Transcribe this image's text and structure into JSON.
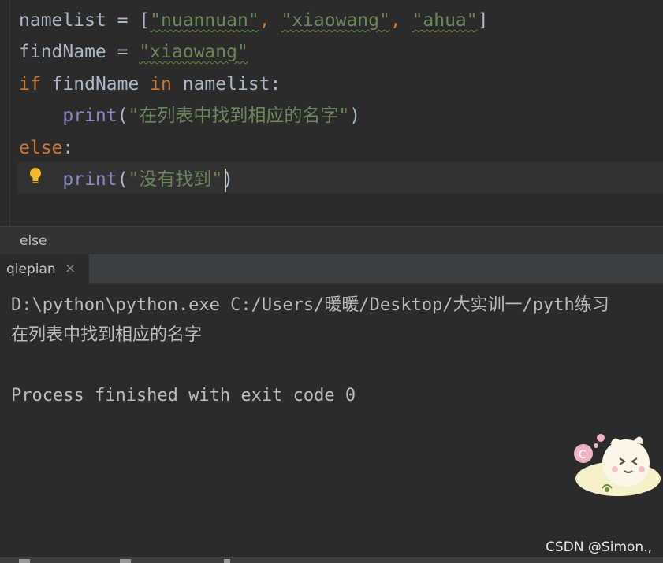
{
  "editor": {
    "lines": [
      {
        "tokens": [
          {
            "text": "namelist = [",
            "cls": ""
          },
          {
            "text": "\"nuannuan\"",
            "cls": "str",
            "squiggle": true
          },
          {
            "text": ", ",
            "cls": "kw"
          },
          {
            "text": "\"xiaowang\"",
            "cls": "str",
            "squiggle": true
          },
          {
            "text": ", ",
            "cls": "kw"
          },
          {
            "text": "\"ahua\"",
            "cls": "str",
            "squiggle": true
          },
          {
            "text": "]",
            "cls": ""
          }
        ]
      },
      {
        "tokens": [
          {
            "text": "findName = ",
            "cls": ""
          },
          {
            "text": "\"xiaowang\"",
            "cls": "str",
            "squiggle": true
          }
        ]
      },
      {
        "tokens": [
          {
            "text": "if",
            "cls": "kw"
          },
          {
            "text": " findName ",
            "cls": ""
          },
          {
            "text": "in",
            "cls": "kw"
          },
          {
            "text": " namelist:",
            "cls": ""
          }
        ]
      },
      {
        "tokens": [
          {
            "text": "    ",
            "cls": ""
          },
          {
            "text": "print",
            "cls": "fn"
          },
          {
            "text": "(",
            "cls": ""
          },
          {
            "text": "\"在列表中找到相应的名字\"",
            "cls": "str"
          },
          {
            "text": ")",
            "cls": ""
          }
        ]
      },
      {
        "tokens": [
          {
            "text": "else",
            "cls": "kw"
          },
          {
            "text": ":",
            "cls": ""
          }
        ]
      },
      {
        "tokens": [
          {
            "text": "    ",
            "cls": ""
          },
          {
            "text": "print",
            "cls": "fn"
          },
          {
            "text": "(",
            "cls": ""
          },
          {
            "text": "\"没有找到\"",
            "cls": "str"
          },
          {
            "text": ")",
            "cls": ""
          }
        ]
      }
    ],
    "intention_icon": "lightbulb-icon"
  },
  "breadcrumb": {
    "text": "else"
  },
  "run_panel": {
    "tab": {
      "label": "qiepian",
      "close_glyph": "×"
    },
    "console": [
      "D:\\python\\python.exe C:/Users/暖暖/Desktop/大实训一/pyth练习",
      "在列表中找到相应的名字",
      "",
      "Process finished with exit code 0"
    ]
  },
  "watermark": "CSDN @Simon.,",
  "colors": {
    "background": "#2b2b2b",
    "keyword": "#cc7832",
    "string": "#6a8759",
    "builtin": "#8888c6",
    "text": "#a9b7c6"
  }
}
